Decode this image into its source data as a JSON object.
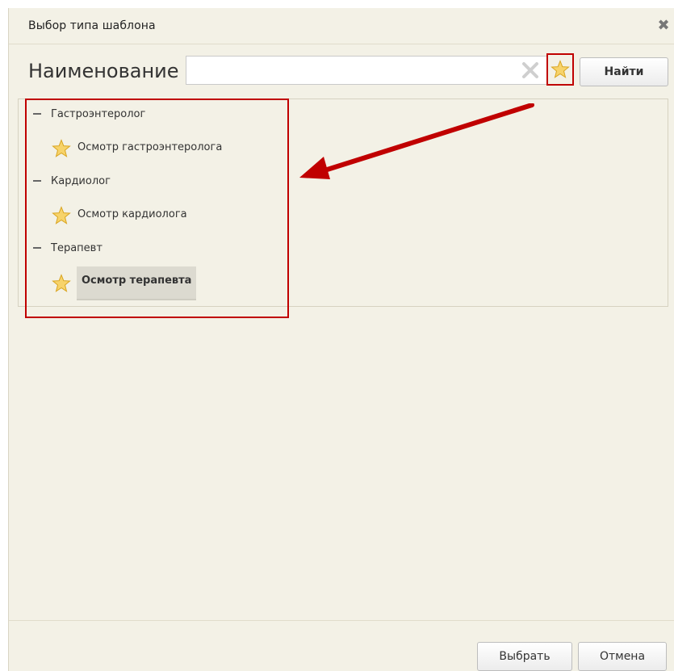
{
  "dialog": {
    "title": "Выбор типа шаблона",
    "close_glyph": "✖"
  },
  "search": {
    "label": "Наименование",
    "value": "",
    "placeholder": "",
    "clear_icon": "clear-x-icon",
    "favorite_icon": "star-icon",
    "find_label": "Найти"
  },
  "tree": {
    "groups": [
      {
        "label": "Гастроэнтеролог",
        "item": "Осмотр гастроэнтеролога"
      },
      {
        "label": "Кардиолог",
        "item": "Осмотр кардиолога"
      },
      {
        "label": "Терапевт",
        "item": "Осмотр терапевта"
      }
    ],
    "selected_item": "Осмотр терапевта"
  },
  "footer": {
    "select_label": "Выбрать",
    "cancel_label": "Отмена"
  },
  "colors": {
    "background": "#f3f1e6",
    "highlight": "#c00000",
    "star": "#f5c33b"
  }
}
